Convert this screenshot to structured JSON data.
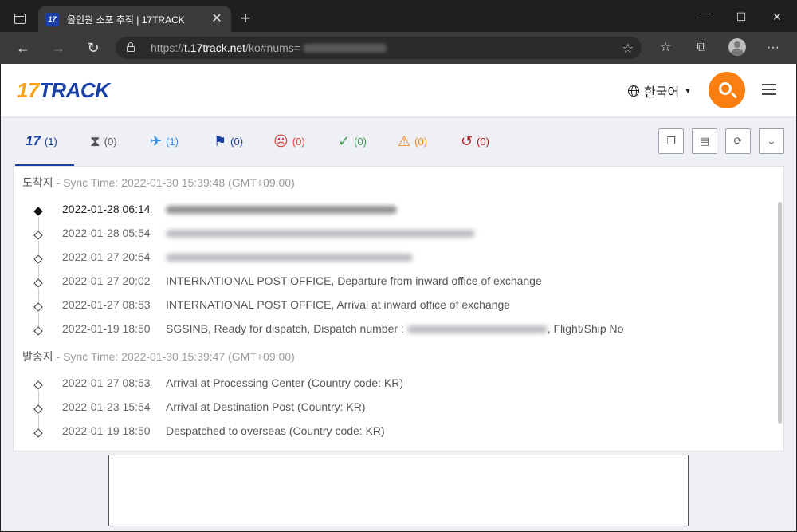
{
  "browser": {
    "tab_title": "올인원 소포 추적 | 17TRACK",
    "favicon_text": "17",
    "url_prefix": "https://",
    "url_host": "t.17track.net",
    "url_path": "/ko#nums="
  },
  "site": {
    "logo_num": "17",
    "logo_text": "TRACK",
    "language": "한국어",
    "brand_orange": "#f97f13",
    "brand_blue": "#1a3fa6"
  },
  "filters": [
    {
      "icon": "17-logo-icon",
      "count": "(1)",
      "color": "#1a3fa6"
    },
    {
      "icon": "hourglass-icon",
      "count": "(0)",
      "color": "#555555"
    },
    {
      "icon": "airplane-icon",
      "count": "(1)",
      "color": "#2f8de4"
    },
    {
      "icon": "flag-icon",
      "count": "(0)",
      "color": "#1a3fa6"
    },
    {
      "icon": "sad-face-icon",
      "count": "(0)",
      "color": "#e0413b"
    },
    {
      "icon": "checkmark-icon",
      "count": "(0)",
      "color": "#3aa14a"
    },
    {
      "icon": "warning-icon",
      "count": "(0)",
      "color": "#f97f13"
    },
    {
      "icon": "history-icon",
      "count": "(0)",
      "color": "#b21f1f"
    }
  ],
  "destination": {
    "label": "도착지",
    "sync": "- Sync Time: 2022-01-30 15:39:48 (GMT+09:00)",
    "events": [
      {
        "time": "2022-01-28 06:14",
        "desc": ""
      },
      {
        "time": "2022-01-28 05:54",
        "desc": ""
      },
      {
        "time": "2022-01-27 20:54",
        "desc": ""
      },
      {
        "time": "2022-01-27 20:02",
        "desc": "INTERNATIONAL POST OFFICE, Departure from inward office of exchange"
      },
      {
        "time": "2022-01-27 08:53",
        "desc": "INTERNATIONAL POST OFFICE, Arrival at inward office of exchange"
      },
      {
        "time": "2022-01-19 18:50",
        "desc": "SGSINB, Ready for dispatch, Dispatch number :",
        "desc_after": ", Flight/Ship No"
      }
    ]
  },
  "origin": {
    "label": "발송지",
    "sync": "- Sync Time: 2022-01-30 15:39:47 (GMT+09:00)",
    "events": [
      {
        "time": "2022-01-27 08:53",
        "desc": "Arrival at Processing Center (Country code: KR)"
      },
      {
        "time": "2022-01-23 15:54",
        "desc": "Arrival at Destination Post (Country: KR)"
      },
      {
        "time": "2022-01-19 18:50",
        "desc": "Despatched to overseas (Country code: KR)"
      }
    ]
  }
}
